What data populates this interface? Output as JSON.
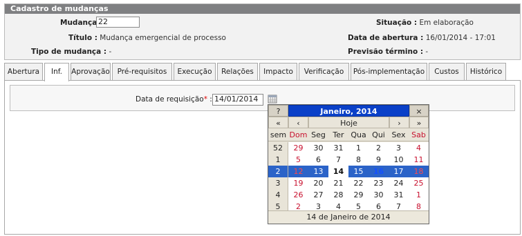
{
  "panel": {
    "title": "Cadastro de mudanças",
    "mudanca_label": "Mudança :",
    "mudanca_value": "22",
    "titulo_label": "Título :",
    "titulo_value": "Mudança emergencial de processo",
    "tipo_label": "Tipo de mudança :",
    "tipo_value": "-",
    "situacao_label": "Situação :",
    "situacao_value": "Em elaboração",
    "abertura_label": "Data de abertura :",
    "abertura_value": "16/01/2014 - 17:01",
    "previsao_label": "Previsão término :",
    "previsao_value": "-"
  },
  "tabs": [
    "Abertura",
    "Inf.",
    "Aprovação",
    "Pré-requisitos",
    "Execução",
    "Relações",
    "Impacto",
    "Verificação",
    "Pós-implementação",
    "Custos",
    "Histórico"
  ],
  "active_tab": "Inf.",
  "form": {
    "date_label": "Data de requisição",
    "required_mark": "*",
    "colon": ":",
    "date_value": "14/01/2014"
  },
  "calendar": {
    "help": "?",
    "title": "Janeiro, 2014",
    "close": "×",
    "prev_year": "«",
    "prev_month": "‹",
    "today": "Hoje",
    "next_month": "›",
    "next_year": "»",
    "week_header": "sem",
    "days": [
      "Dom",
      "Seg",
      "Ter",
      "Qua",
      "Qui",
      "Sex",
      "Sab"
    ],
    "weeks": [
      {
        "w": "52",
        "d": [
          "29",
          "30",
          "31",
          "1",
          "2",
          "3",
          "4"
        ]
      },
      {
        "w": "1",
        "d": [
          "5",
          "6",
          "7",
          "8",
          "9",
          "10",
          "11"
        ]
      },
      {
        "w": "2",
        "d": [
          "12",
          "13",
          "14",
          "15",
          "16",
          "17",
          "18"
        ]
      },
      {
        "w": "3",
        "d": [
          "19",
          "20",
          "21",
          "22",
          "23",
          "24",
          "25"
        ]
      },
      {
        "w": "4",
        "d": [
          "26",
          "27",
          "28",
          "29",
          "30",
          "31",
          "1"
        ]
      },
      {
        "w": "5",
        "d": [
          "2",
          "3",
          "4",
          "5",
          "6",
          "7",
          "8"
        ]
      }
    ],
    "footer": "14 de Janeiro de 2014",
    "colors": {
      "title_bg": "#0a40c8",
      "selected_row": "#2b63c8",
      "weekend": "#c8102e",
      "current_day": "#1450ff"
    }
  }
}
